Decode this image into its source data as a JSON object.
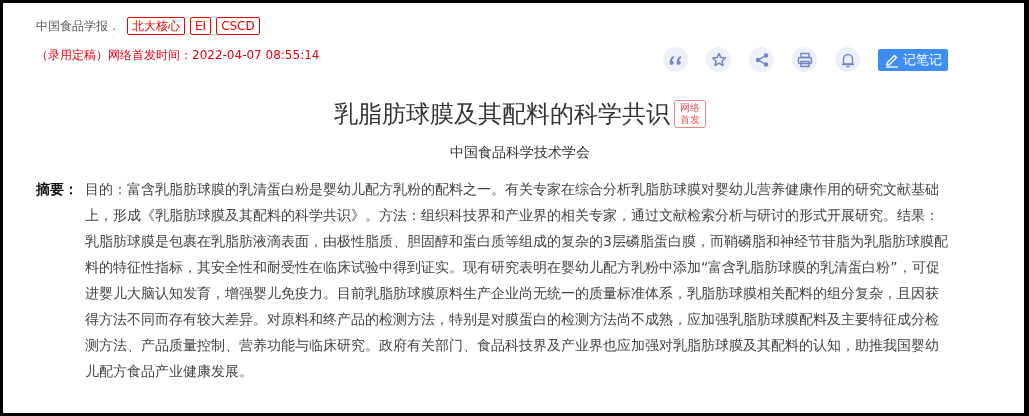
{
  "journal": {
    "name": "中国食品学报．",
    "tags": [
      "北大核心",
      "EI",
      "CSCD"
    ]
  },
  "publish_info": "（录用定稿）网络首发时间：2022-04-07 08:55:14",
  "actions": [
    {
      "kind": "quote"
    },
    {
      "kind": "star"
    },
    {
      "kind": "share"
    },
    {
      "kind": "print"
    },
    {
      "kind": "bell"
    }
  ],
  "note_button": "记笔记",
  "title": "乳脂肪球膜及其配料的科学共识",
  "title_badge": "网络首发",
  "author": "中国食品科学技术学会",
  "abstract": {
    "label": "摘要：",
    "text": "目的：富含乳脂肪球膜的乳清蛋白粉是婴幼儿配方乳粉的配料之一。有关专家在综合分析乳脂肪球膜对婴幼儿营养健康作用的研究文献基础上，形成《乳脂肪球膜及其配料的科学共识》。方法：组织科技界和产业界的相关专家，通过文献检索分析与研讨的形式开展研究。结果：乳脂肪球膜是包裹在乳脂肪液滴表面，由极性脂质、胆固醇和蛋白质等组成的复杂的3层磷脂蛋白膜，而鞘磷脂和神经节苷脂为乳脂肪球膜配料的特征性指标，其安全性和耐受性在临床试验中得到证实。现有研究表明在婴幼儿配方乳粉中添加“富含乳脂肪球膜的乳清蛋白粉”，可促进婴儿大脑认知发育，增强婴儿免疫力。目前乳脂肪球膜原料生产企业尚无统一的质量标准体系，乳脂肪球膜相关配料的组分复杂，且因获得方法不同而存有较大差异。对原料和终产品的检测方法，特别是对膜蛋白的检测方法尚不成熟，应加强乳脂肪球膜配料及主要特征成分检测方法、产品质量控制、营养功能与临床研究。政府有关部门、食品科技界及产业界也应加强对乳脂肪球膜及其配料的认知，助推我国婴幼儿配方食品产业健康发展。"
  }
}
